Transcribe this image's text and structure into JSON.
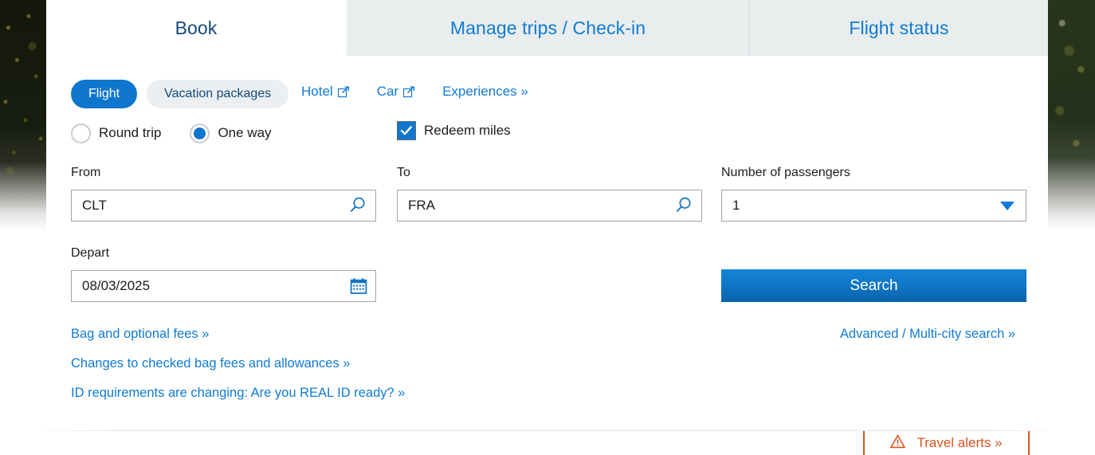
{
  "tabs": [
    {
      "label": "Book",
      "active": true
    },
    {
      "label": "Manage trips / Check-in",
      "active": false
    },
    {
      "label": "Flight status",
      "active": false
    }
  ],
  "product_pills": [
    {
      "label": "Flight",
      "selected": true
    },
    {
      "label": "Vacation packages",
      "selected": false
    }
  ],
  "external_links": [
    {
      "label": "Hotel",
      "icon": "external-link-icon"
    },
    {
      "label": "Car",
      "icon": "external-link-icon"
    },
    {
      "label": "Experiences »",
      "icon": "none"
    }
  ],
  "trip_type": {
    "options": [
      {
        "label": "Round trip",
        "selected": false
      },
      {
        "label": "One way",
        "selected": true
      }
    ]
  },
  "redeem_miles": {
    "label": "Redeem miles",
    "checked": true
  },
  "form": {
    "from": {
      "label": "From",
      "value": "CLT",
      "icon": "search-icon"
    },
    "to": {
      "label": "To",
      "value": "FRA",
      "icon": "search-icon"
    },
    "passengers": {
      "label": "Number of passengers",
      "value": "1",
      "icon": "chevron-down-icon"
    },
    "depart": {
      "label": "Depart",
      "value": "08/03/2025",
      "icon": "calendar-icon"
    },
    "search_button": "Search"
  },
  "footer_links": [
    "Bag and optional fees »",
    "Changes to checked bag fees and allowances »",
    "ID requirements are changing: Are you REAL ID ready? »"
  ],
  "advanced_link": "Advanced / Multi-city search »",
  "travel_alerts": {
    "label": "Travel alerts »",
    "icon": "warning-triangle-icon"
  },
  "colors": {
    "brand_blue": "#0f76cd",
    "link_blue": "#0f7bd4",
    "tab_navy": "#13497e",
    "tab_inactive_bg": "#e9edee",
    "alert_orange": "#d9541e",
    "field_border": "#9aa6ae"
  }
}
